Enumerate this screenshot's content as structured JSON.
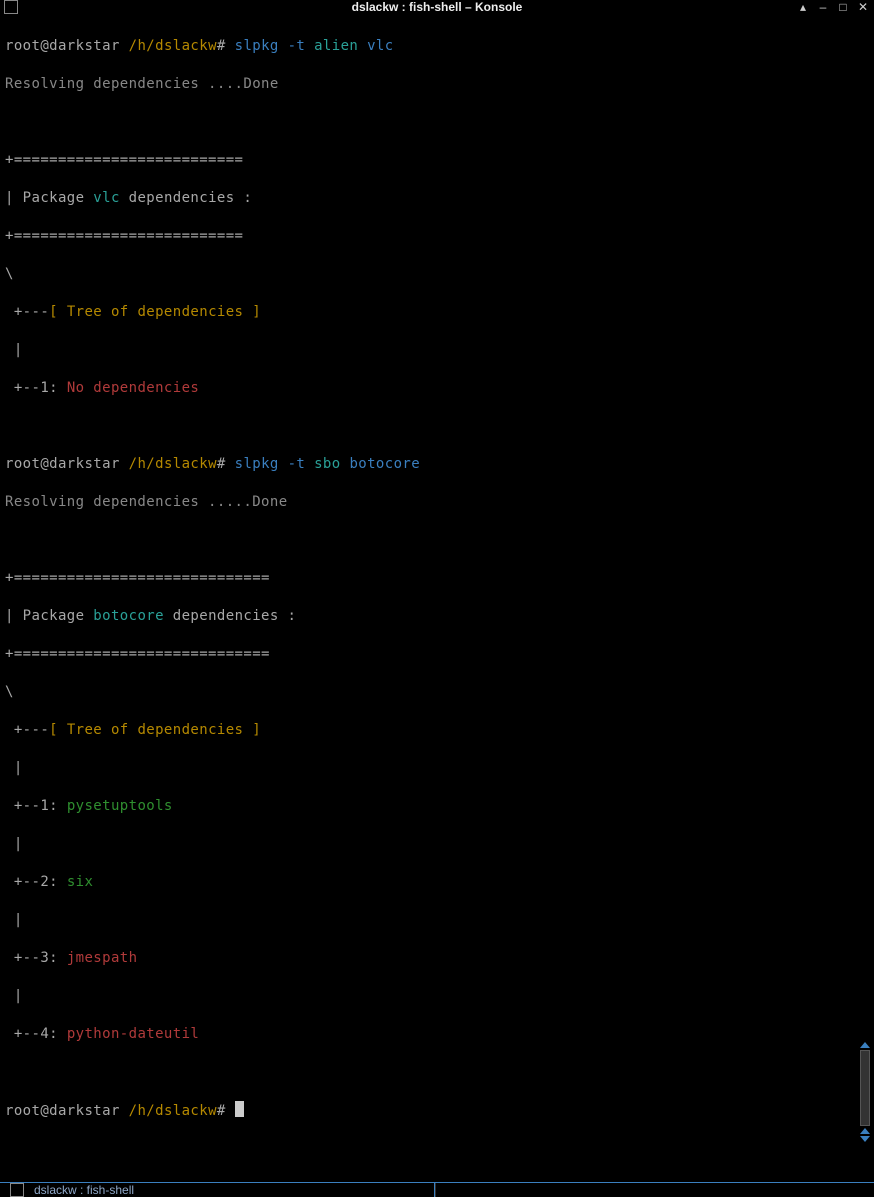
{
  "window": {
    "title": "dslackw : fish-shell – Konsole"
  },
  "prompt": {
    "user_host": "root@darkstar",
    "path": "/h/dslackw",
    "symbol": "#"
  },
  "commands": {
    "first": {
      "cmd": "slpkg -t",
      "arg1": "alien",
      "arg2": "vlc"
    },
    "second": {
      "cmd": "slpkg -t",
      "arg1": "sbo",
      "arg2": "botocore"
    }
  },
  "output1": {
    "resolving": "Resolving dependencies ....Done",
    "border": "+==========================",
    "package_prefix": "| Package ",
    "package_name": "vlc",
    "package_suffix": " dependencies :",
    "border2": "+==========================",
    "backslash": "\\",
    "tree_prefix": " +---",
    "tree_label": "[ Tree of dependencies ]",
    "pipe": " |",
    "dep1_prefix": " +--1: ",
    "dep1": "No dependencies"
  },
  "output2": {
    "resolving": "Resolving dependencies .....Done",
    "border": "+=============================",
    "package_prefix": "| Package ",
    "package_name": "botocore",
    "package_suffix": " dependencies :",
    "border2": "+=============================",
    "backslash": "\\",
    "tree_prefix": " +---",
    "tree_label": "[ Tree of dependencies ]",
    "pipe": " |",
    "dep1_prefix": " +--1: ",
    "dep1": "pysetuptools",
    "dep2_prefix": " +--2: ",
    "dep2": "six",
    "dep3_prefix": " +--3: ",
    "dep3": "jmespath",
    "dep4_prefix": " +--4: ",
    "dep4": "python-dateutil"
  },
  "tab": {
    "label": "dslackw : fish-shell"
  }
}
